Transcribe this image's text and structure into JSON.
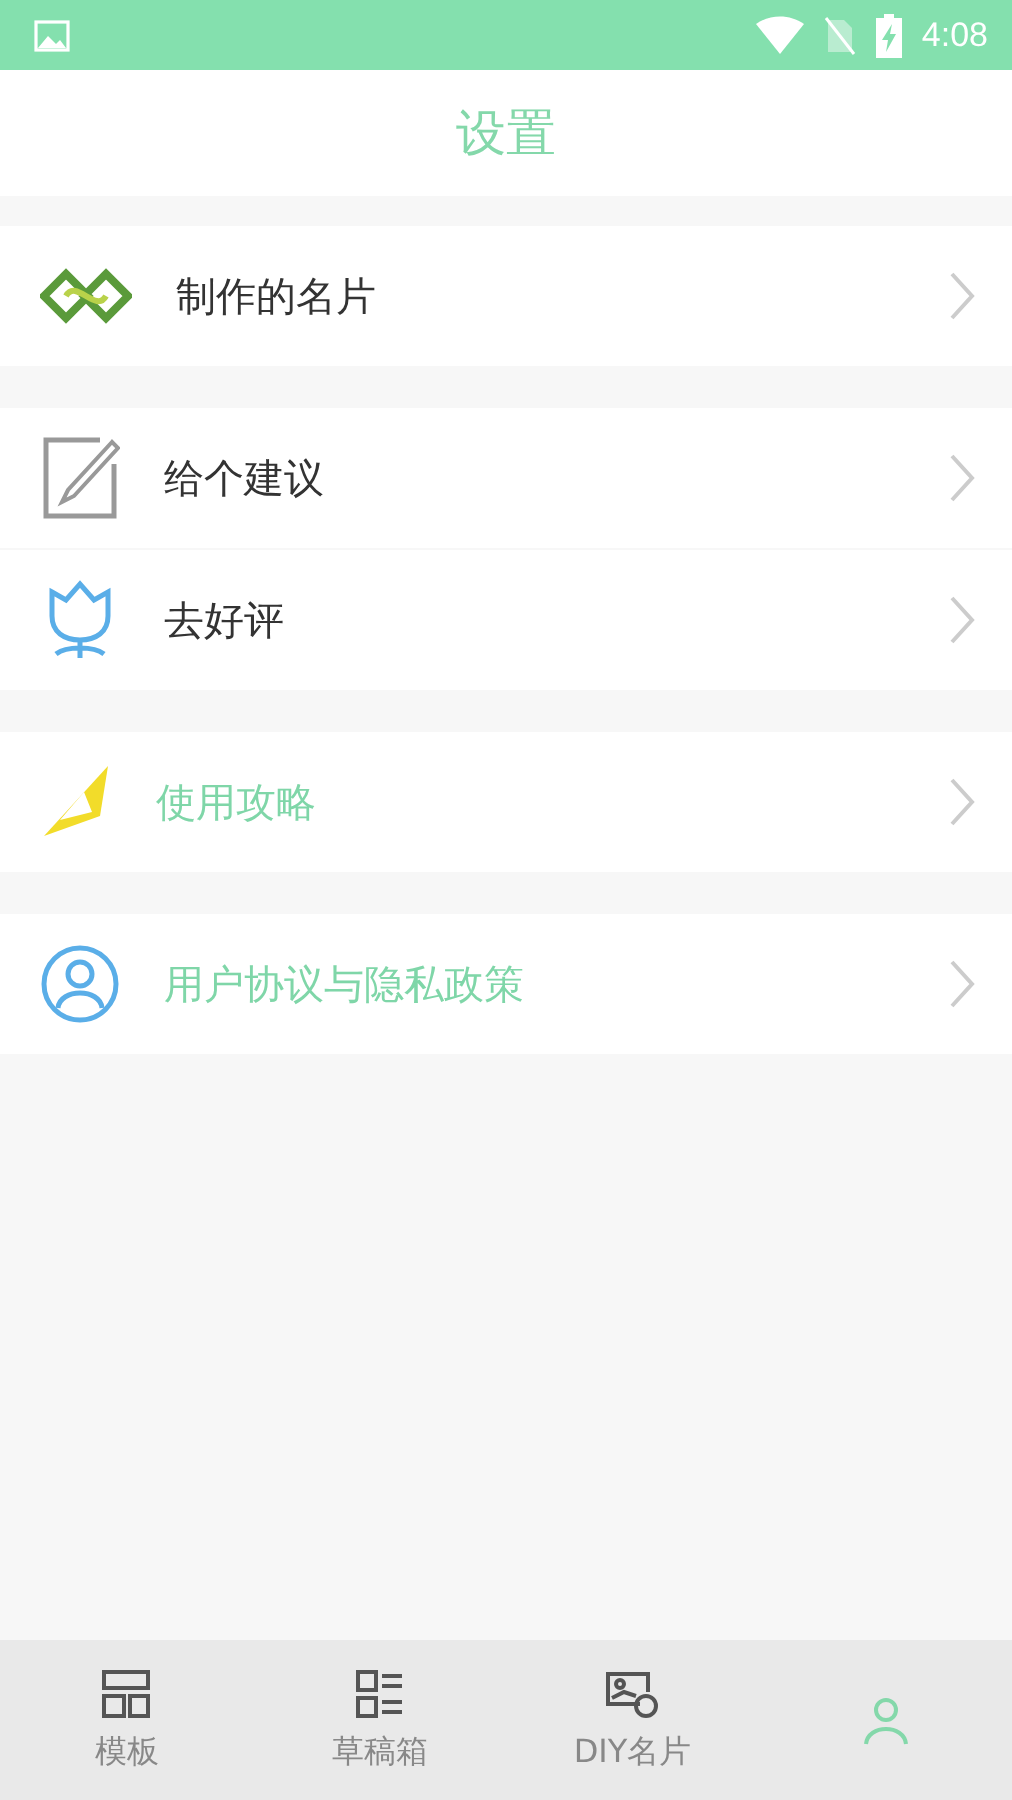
{
  "status_bar": {
    "time": "4:08"
  },
  "header": {
    "title": "设置"
  },
  "sections": [
    {
      "items": [
        {
          "kind": "card",
          "label": "制作的名片",
          "highlighted": false
        }
      ]
    },
    {
      "items": [
        {
          "kind": "pencil",
          "label": "给个建议",
          "highlighted": false
        },
        {
          "kind": "tulip",
          "label": "去好评",
          "highlighted": false
        }
      ]
    },
    {
      "items": [
        {
          "kind": "kite",
          "label": "使用攻略",
          "highlighted": true
        }
      ]
    },
    {
      "items": [
        {
          "kind": "user",
          "label": "用户协议与隐私政策",
          "highlighted": true
        }
      ]
    }
  ],
  "bottom_nav": [
    {
      "kind": "template",
      "label": "模板",
      "selected": false
    },
    {
      "kind": "drafts",
      "label": "草稿箱",
      "selected": false
    },
    {
      "kind": "diy",
      "label": "DIY名片",
      "selected": false
    },
    {
      "kind": "mine",
      "selected": true
    }
  ]
}
